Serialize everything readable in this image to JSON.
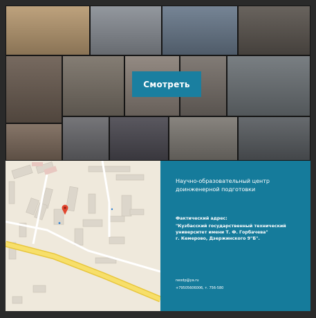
{
  "gallery": {
    "watch_button_label": "Смотреть",
    "tiles": [
      {
        "name": "photo-tile-cubes",
        "color": "#b89a72"
      },
      {
        "name": "photo-tile-robot-machine",
        "color": "#8a8f96"
      },
      {
        "name": "photo-tile-robot-kit",
        "color": "#6a7a8c"
      },
      {
        "name": "photo-tile-ribbon-cutting",
        "color": "#5c5650"
      },
      {
        "name": "photo-tile-boy-portrait",
        "color": "#6b5d52"
      },
      {
        "name": "photo-tile-workshop-1",
        "color": "#7a7268"
      },
      {
        "name": "photo-tile-girl-table",
        "color": "#8a8078"
      },
      {
        "name": "photo-tile-boy-computer",
        "color": "#77706a"
      },
      {
        "name": "photo-tile-computer-class",
        "color": "#6e7478"
      },
      {
        "name": "photo-tile-boy-small",
        "color": "#7c6a5c"
      },
      {
        "name": "photo-tile-children-group",
        "color": "#6a6a6e"
      },
      {
        "name": "photo-tile-officials",
        "color": "#4c4a52"
      },
      {
        "name": "photo-tile-robot-build",
        "color": "#7e7a74"
      },
      {
        "name": "photo-tile-hardware",
        "color": "#5a5e62"
      }
    ]
  },
  "map": {
    "bg_color": "#efe9dc",
    "road_color": "#f3d64a",
    "marker_color": "#e2452e"
  },
  "info": {
    "title_line1": "Научно-образовательный центр",
    "title_line2": "доинженерной подготовки",
    "address_label": "Фактический адрес:",
    "address_line1": "\"Кузбасский государственный технический",
    "address_line2": "университет имени Т. Ф. Горбачева\"",
    "address_line3": "г. Кемерово, Дзержинского 9\"Б\".",
    "email": "neodp@ya.ru",
    "phone": "+79505606006, т. 756-580",
    "bg_color": "#157b9b"
  }
}
